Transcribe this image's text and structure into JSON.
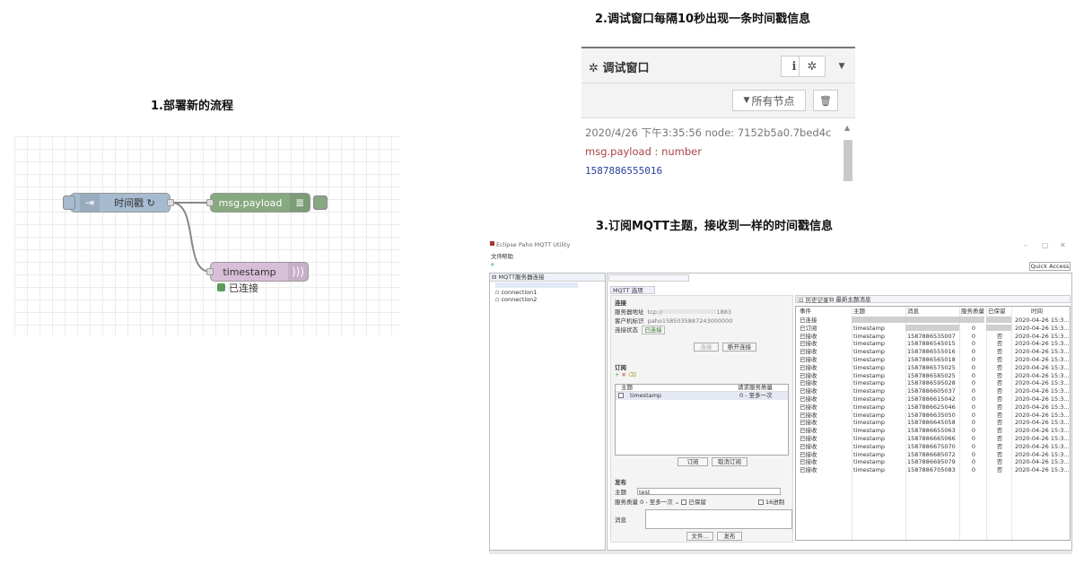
{
  "captions": {
    "step1": "1.部署新的流程",
    "step2": "2.调试窗口每隔10秒出现一条时间戳信息",
    "step3": "3.订阅MQTT主题，接收到一样的时间戳信息"
  },
  "flow": {
    "inject_label": "时间戳 ↻",
    "debug_label": "msg.payload",
    "mqtt_out_label": "timestamp",
    "mqtt_status": "已连接",
    "colors": {
      "inject": "#a6bbcf",
      "debug": "#87a980",
      "mqtt": "#d8bfd8",
      "status_green": "#5a9a5a"
    }
  },
  "debug": {
    "title_icon": "bug-icon",
    "title": "调试窗口",
    "info_button": "i",
    "bug_button": "bug-icon",
    "filter_label": "所有节点",
    "message_meta": "2020/4/26 下午3:35:56   node: 7152b5a0.7bed4c",
    "message_topic": "msg.payload : number",
    "message_value": "1587886555016"
  },
  "paho": {
    "window_title": "Eclipse Paho MQTT Utility",
    "menu": [
      "文件",
      "帮助"
    ],
    "quick_access": "Quick Access",
    "tree_header": "MQTT服务器连接",
    "tree_items": [
      "connection1",
      "connection2"
    ],
    "tabs": {
      "mqtt": "MQTT",
      "options": "选项"
    },
    "connection": {
      "section": "连接",
      "server_label": "服务器地址",
      "server_value": "tcp://",
      "server_port": "1883",
      "client_label": "客户机标识",
      "client_value": "paho1585035887243000000",
      "status_label": "连接状态",
      "status_value": "已连接",
      "connect_btn": "连接",
      "disconnect_btn": "断开连接"
    },
    "subscribe": {
      "section": "订阅",
      "col_topic": "主题",
      "col_qos": "请求服务质量",
      "row_topic": "timestamp",
      "row_qos": "0 - 至多一次",
      "subscribe_btn": "订阅",
      "unsubscribe_btn": "取消订阅"
    },
    "publish": {
      "section": "发布",
      "topic_label": "主题",
      "topic_value": "test",
      "qos_label": "服务质量",
      "qos_value": "0 - 至多一次",
      "retain_label": "已保留",
      "hex_label": "16进制",
      "message_label": "消息",
      "file_btn": "文件...",
      "publish_btn": "发布"
    },
    "history": {
      "tab_history": "历史记录",
      "tab_latest": "最新主题消息",
      "columns": [
        "事件",
        "主题",
        "消息",
        "服务质量",
        "已保留",
        "时间"
      ],
      "rows": [
        [
          "已连接",
          "",
          "",
          "",
          "",
          "2020-04-26 15:3..."
        ],
        [
          "已订阅",
          "timestamp",
          "",
          "0",
          "",
          "2020-04-26 15:3..."
        ],
        [
          "已接收",
          "timestamp",
          "1587886535007",
          "0",
          "否",
          "2020-04-26 15:3..."
        ],
        [
          "已接收",
          "timestamp",
          "1587886545015",
          "0",
          "否",
          "2020-04-26 15:3..."
        ],
        [
          "已接收",
          "timestamp",
          "1587886555016",
          "0",
          "否",
          "2020-04-26 15:3..."
        ],
        [
          "已接收",
          "timestamp",
          "1587886565018",
          "0",
          "否",
          "2020-04-26 15:3..."
        ],
        [
          "已接收",
          "timestamp",
          "1587886575025",
          "0",
          "否",
          "2020-04-26 15:3..."
        ],
        [
          "已接收",
          "timestamp",
          "1587886585025",
          "0",
          "否",
          "2020-04-26 15:3..."
        ],
        [
          "已接收",
          "timestamp",
          "1587886595028",
          "0",
          "否",
          "2020-04-26 15:3..."
        ],
        [
          "已接收",
          "timestamp",
          "1587886605037",
          "0",
          "否",
          "2020-04-26 15:3..."
        ],
        [
          "已接收",
          "timestamp",
          "1587886615042",
          "0",
          "否",
          "2020-04-26 15:3..."
        ],
        [
          "已接收",
          "timestamp",
          "1587886625046",
          "0",
          "否",
          "2020-04-26 15:3..."
        ],
        [
          "已接收",
          "timestamp",
          "1587886635050",
          "0",
          "否",
          "2020-04-26 15:3..."
        ],
        [
          "已接收",
          "timestamp",
          "1587886645058",
          "0",
          "否",
          "2020-04-26 15:3..."
        ],
        [
          "已接收",
          "timestamp",
          "1587886655063",
          "0",
          "否",
          "2020-04-26 15:3..."
        ],
        [
          "已接收",
          "timestamp",
          "1587886665066",
          "0",
          "否",
          "2020-04-26 15:3..."
        ],
        [
          "已接收",
          "timestamp",
          "1587886675070",
          "0",
          "否",
          "2020-04-26 15:3..."
        ],
        [
          "已接收",
          "timestamp",
          "1587886685072",
          "0",
          "否",
          "2020-04-26 15:3..."
        ],
        [
          "已接收",
          "timestamp",
          "1587886695079",
          "0",
          "否",
          "2020-04-26 15:3..."
        ],
        [
          "已接收",
          "timestamp",
          "1587886705083",
          "0",
          "否",
          "2020-04-26 15:3..."
        ]
      ]
    }
  }
}
